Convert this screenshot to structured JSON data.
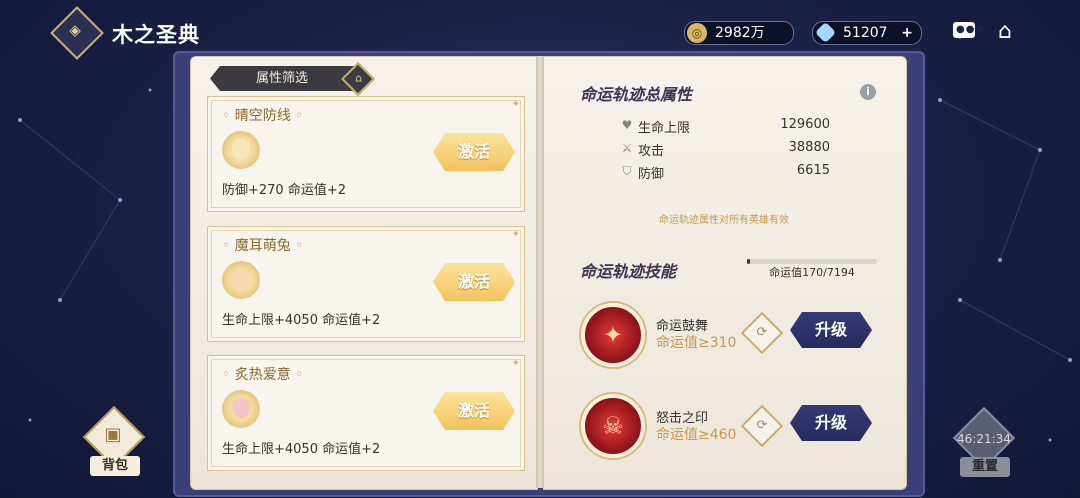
{
  "header": {
    "title": "木之圣典",
    "gold_value": "2982万",
    "gem_value": "51207",
    "gem_plus": "+"
  },
  "left_page": {
    "filter_label": "属性筛选",
    "cards": [
      {
        "name": "晴空防线",
        "desc": "防御+270 命运值+2",
        "button": "激活"
      },
      {
        "name": "魔耳萌兔",
        "desc": "生命上限+4050 命运值+2",
        "button": "激活"
      },
      {
        "name": "炙热爱意",
        "desc": "生命上限+4050 命运值+2",
        "button": "激活"
      }
    ]
  },
  "right_page": {
    "total_title": "命运轨迹总属性",
    "stats": [
      {
        "label": "生命上限",
        "value": "129600",
        "icon": "heart-icon"
      },
      {
        "label": "攻击",
        "value": "38880",
        "icon": "sword-icon"
      },
      {
        "label": "防御",
        "value": "6615",
        "icon": "shield-icon"
      }
    ],
    "note": "命运轨迹属性对所有英雄有效",
    "skills_title": "命运轨迹技能",
    "progress": {
      "label": "命运值170/7194",
      "current": 170,
      "max": 7194
    },
    "skills": [
      {
        "name": "命运鼓舞",
        "req": "命运值≥310",
        "button": "升级"
      },
      {
        "name": "怒击之印",
        "req": "命运值≥460",
        "button": "升级"
      }
    ]
  },
  "bottom": {
    "bag_label": "背包",
    "reset_timer": "46:21:34",
    "reset_label": "重置"
  },
  "colors": {
    "background": "#1b2248",
    "activate_button": "#f2c35e",
    "upgrade_button": "#2a3068",
    "gold_text": "#c79a4c"
  }
}
